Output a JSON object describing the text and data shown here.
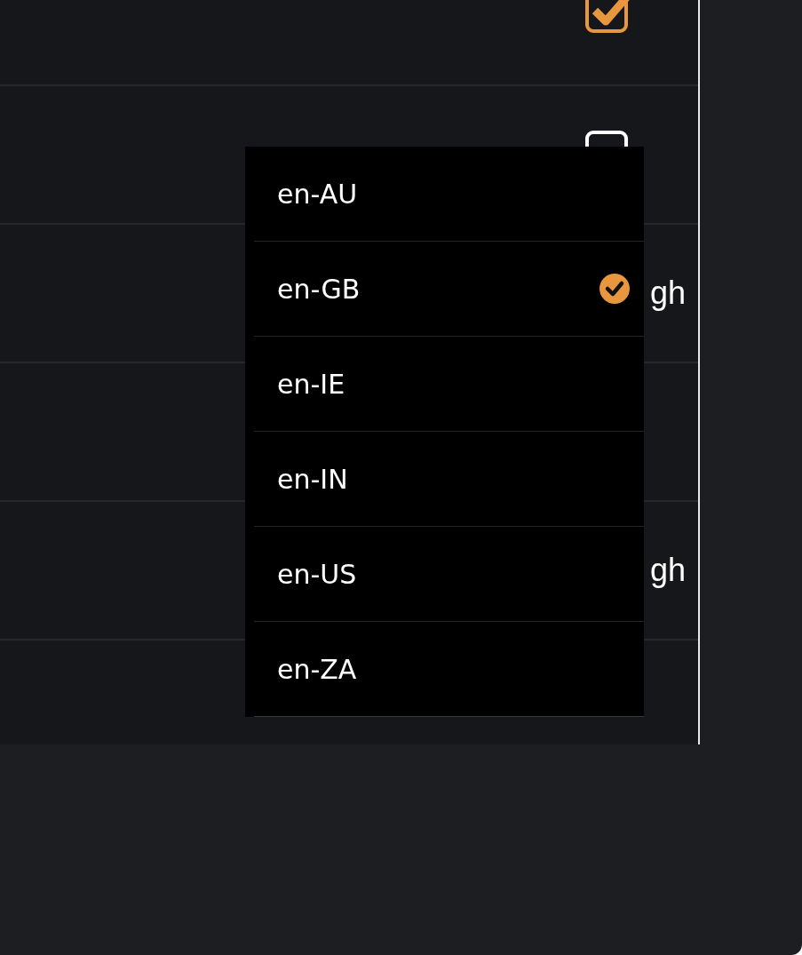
{
  "table": {
    "rows": [
      {
        "kind": "checkbox",
        "checked": true
      },
      {
        "kind": "checkbox",
        "checked": false
      },
      {
        "kind": "level",
        "text": "gh"
      },
      {
        "kind": "blank"
      },
      {
        "kind": "level",
        "text": "gh"
      },
      {
        "kind": "blank"
      }
    ]
  },
  "dropdown": {
    "items": [
      {
        "label": "en-AU",
        "selected": false
      },
      {
        "label": "en-GB",
        "selected": true
      },
      {
        "label": "en-IE",
        "selected": false
      },
      {
        "label": "en-IN",
        "selected": false
      },
      {
        "label": "en-US",
        "selected": false
      },
      {
        "label": "en-ZA",
        "selected": false
      }
    ]
  }
}
